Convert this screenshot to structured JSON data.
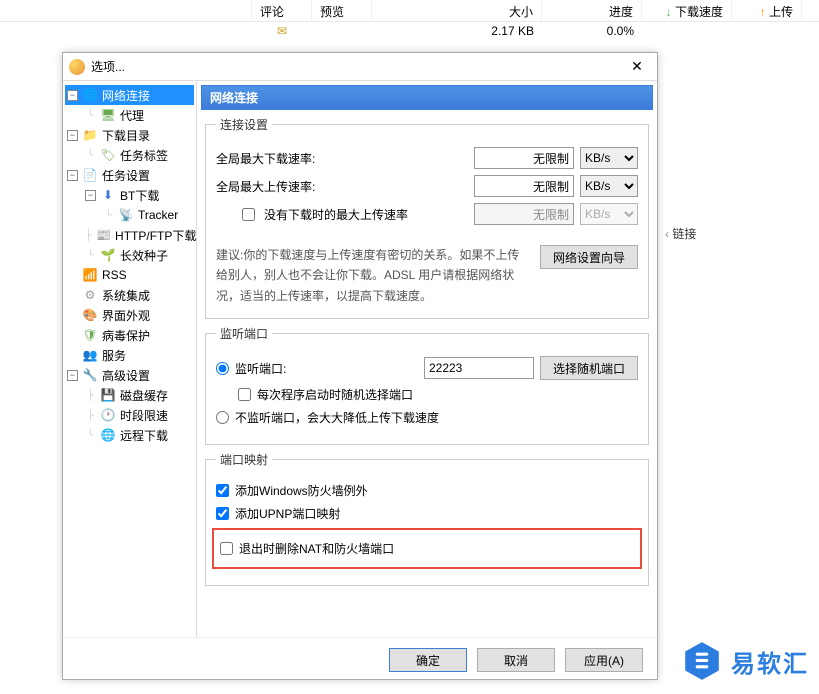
{
  "bg": {
    "headers": {
      "comment": "评论",
      "preview": "预览",
      "size": "大小",
      "progress": "进度",
      "down_speed": "下载速度",
      "up_speed": "上传"
    },
    "row": {
      "size": "2.17 KB",
      "progress": "0.0%"
    },
    "link_label": "链接"
  },
  "dialog": {
    "title": "选项...",
    "close": "✕",
    "panel_title": "网络连接",
    "tree": {
      "network": "网络连接",
      "proxy": "代理",
      "download_dir": "下载目录",
      "task_tag": "任务标签",
      "task_settings": "任务设置",
      "bt": "BT下载",
      "tracker": "Tracker",
      "http": "HTTP/FTP下载",
      "seed": "长效种子",
      "rss": "RSS",
      "sys": "系统集成",
      "ui": "界面外观",
      "virus": "病毒保护",
      "service": "服务",
      "advanced": "高级设置",
      "disk": "磁盘缓存",
      "time": "时段限速",
      "remote": "远程下载"
    },
    "conn": {
      "legend": "连接设置",
      "max_down": "全局最大下载速率:",
      "max_up": "全局最大上传速率:",
      "no_dl_up": "没有下载时的最大上传速率",
      "unlimited": "无限制",
      "unit": "KB/s",
      "hint": "建议:你的下载速度与上传速度有密切的关系。如果不上传给别人，别人也不会让你下载。ADSL 用户请根据网络状况，适当的上传速率，以提高下载速度。",
      "wizard": "网络设置向导"
    },
    "listen": {
      "legend": "监听端口",
      "listen_port": "监听端口:",
      "port_value": "22223",
      "random_btn": "选择随机端口",
      "random_on_start": "每次程序启动时随机选择端口",
      "no_listen": "不监听端口，会大大降低上传下载速度"
    },
    "mapping": {
      "legend": "端口映射",
      "firewall": "添加Windows防火墙例外",
      "upnp": "添加UPNP端口映射",
      "remove_on_exit": "退出时删除NAT和防火墙端口"
    },
    "buttons": {
      "ok": "确定",
      "cancel": "取消",
      "apply": "应用(A)"
    }
  },
  "watermark": "易软汇"
}
